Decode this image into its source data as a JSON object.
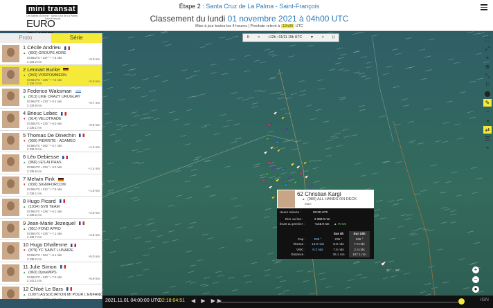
{
  "header": {
    "logo_mini": "mini transat",
    "logo_sub": "Les Sables d'Olonne · Santa Cruz de La Palma · Saint-François",
    "logo_euro": "EURO CHEF",
    "stage_prefix": "Étape 2 :",
    "stage_title": "Santa Cruz de La Palma - Saint-François",
    "class_prefix": "Classement du lundi",
    "class_date": "01 novembre 2021 à 04h00 UTC",
    "update_prefix": "Mise à jour toutes les 4 heures | Prochain relevé à",
    "update_time": "12h00",
    "update_suffix": "UTC"
  },
  "tabs": [
    {
      "label": "Proto",
      "active": false
    },
    {
      "label": "Série",
      "active": true
    }
  ],
  "rankings": [
    {
      "rank": "1",
      "name": "Cécile Andrieu",
      "flag": "fr",
      "boat": "(893) GROUPE ADRE",
      "trend": "up",
      "d1": "03:58UTC • 237 ° • 7.5 nds",
      "d2": "2 234.2 nm",
      "gap": "+0.0 nm",
      "highlight": false
    },
    {
      "rank": "2",
      "name": "Lennart Burke",
      "flag": "de",
      "boat": "(943) VORPOMMERN",
      "trend": "up",
      "d1": "03:58UTC • 236 ° • 7.6 nds",
      "d2": "2 234.2 nm",
      "gap": "+0.0 nm",
      "highlight": true
    },
    {
      "rank": "3",
      "name": "Federico Waksman",
      "flag": "uy",
      "boat": "(913) LIKE CRAZY URUGUAY",
      "trend": "up",
      "d1": "03:58UTC • 233 ° • 6.2 nds",
      "d2": "2 234.8 nm",
      "gap": "+0.7 nm",
      "highlight": false
    },
    {
      "rank": "4",
      "name": "Brieuc Lebec",
      "flag": "fr",
      "boat": "(914) VELOTRADE",
      "trend": "down",
      "d1": "03:58UTC • 233 ° • 8.0 nds",
      "d2": "2 235.1 nm",
      "gap": "+0.9 nm",
      "highlight": false
    },
    {
      "rank": "5",
      "name": "Thomas De Dinechin",
      "flag": "fr",
      "boat": "(909) PIERRITE - ADAMEO",
      "trend": "down",
      "d1": "03:58UTC • 252 ° • 5.7 nds",
      "d2": "2 235.3 nm",
      "gap": "+1.2 nm",
      "highlight": false
    },
    {
      "rank": "6",
      "name": "Léo Debiesse",
      "flag": "fr",
      "boat": "(966) LES ALPHAS",
      "trend": "up",
      "d1": "03:58UTC • 234 ° • 8.0 nds",
      "d2": "2 235.6 nm",
      "gap": "+1.4 nm",
      "highlight": false
    },
    {
      "rank": "7",
      "name": "Melwin Fink",
      "flag": "de",
      "boat": "(930) SIGNIFORCOM",
      "trend": "down",
      "d1": "03:58UTC • 212 ° • 7.9 nds",
      "d2": "2 236.1 nm",
      "gap": "+1.9 nm",
      "highlight": false
    },
    {
      "rank": "8",
      "name": "Hugo Picard",
      "flag": "fr",
      "boat": "(1034) SVB TEAM",
      "trend": "up",
      "d1": "03:58UTC • 236 ° • 6.1 nds",
      "d2": "2 236.2 nm",
      "gap": "+2.0 nm",
      "highlight": false
    },
    {
      "rank": "9",
      "name": "Jean-Marie Jezequel",
      "flag": "fr",
      "boat": "(951) FOND APRO",
      "trend": "up",
      "d1": "03:58UTC • 230 ° • 7.1 nds",
      "d2": "2 236.7 nm",
      "gap": "+2.5 nm",
      "highlight": false
    },
    {
      "rank": "10",
      "name": "Hugo Dhallenne",
      "flag": "fr",
      "boat": "(979) YC SAINT LUNAIRE",
      "trend": "down",
      "d1": "03:58UTC • 224 ° • 6.1 nds",
      "d2": "2 239.2 nm",
      "gap": "+5.0 nm",
      "highlight": false
    },
    {
      "rank": "11",
      "name": "Julie Simon",
      "flag": "fr",
      "boat": "(963) DynaMIPS",
      "trend": "up",
      "d1": "03:58UTC • 230 ° • 7.0 nds",
      "d2": "2 241.1 nm",
      "gap": "+6.9 nm",
      "highlight": false
    },
    {
      "rank": "12",
      "name": "Chloé Le Bars",
      "flag": "fr",
      "boat": "(1007) ASSOCIATION MI POUR L'ENFANCE",
      "trend": "up",
      "d1": "03:58UTC • 230 ° • 7.0 nds",
      "d2": "2 241.4 nm",
      "gap": "+7.3 nm",
      "highlight": false
    }
  ],
  "timectrl": {
    "prev": "K",
    "back": "<",
    "label": "+12h : 01/11 15h UTC",
    "dropdown": "▼",
    "forward": ">",
    "next": "⟩|"
  },
  "popup": {
    "rank": "62",
    "name": "Christian Kargl",
    "boat": "(980) ALL HANDS ON DECK",
    "class": "Maxi",
    "time_label": "Heure relevée :",
    "time_value": "03:30 UTC",
    "dist_label": "Dist. au but :",
    "dist_value": "2 380.0 nm",
    "gap_label": "Écart au premier :",
    "gap_value": "+145.9 nm",
    "gap_trend": "▲ 70 nm",
    "table_header": [
      "",
      "",
      "Sur 4h",
      "Sur 24h"
    ],
    "table_rows": [
      [
        "Cap :",
        "236 °",
        "235 °",
        "196 °"
      ],
      [
        "Vitesse :",
        "13.0 nds",
        "8.8 nds",
        "7.0 nds"
      ],
      [
        "VMC :",
        "9.3 nds",
        "7.5 nds",
        "2.4 nds"
      ],
      [
        "Distance :",
        "",
        "35.1 nm",
        "167.1 nm"
      ]
    ]
  },
  "map": {
    "coord_readout": "31° ... 28° ..."
  },
  "tools": [
    "⛶",
    "⤢",
    "⌖",
    "⊕",
    "⤡",
    "⚐",
    "⬤",
    "✎",
    "~",
    "◑",
    "⇄",
    "☰",
    "⌁"
  ],
  "zoom": {
    "plus": "+",
    "minus": "−",
    "reset": "●"
  },
  "bottom": {
    "datetime": "2021.11.01 04:00:00 UTC",
    "counter": "02:18:04:51",
    "controls": "◀ ▶ ▶▶",
    "brand": "IGN"
  }
}
